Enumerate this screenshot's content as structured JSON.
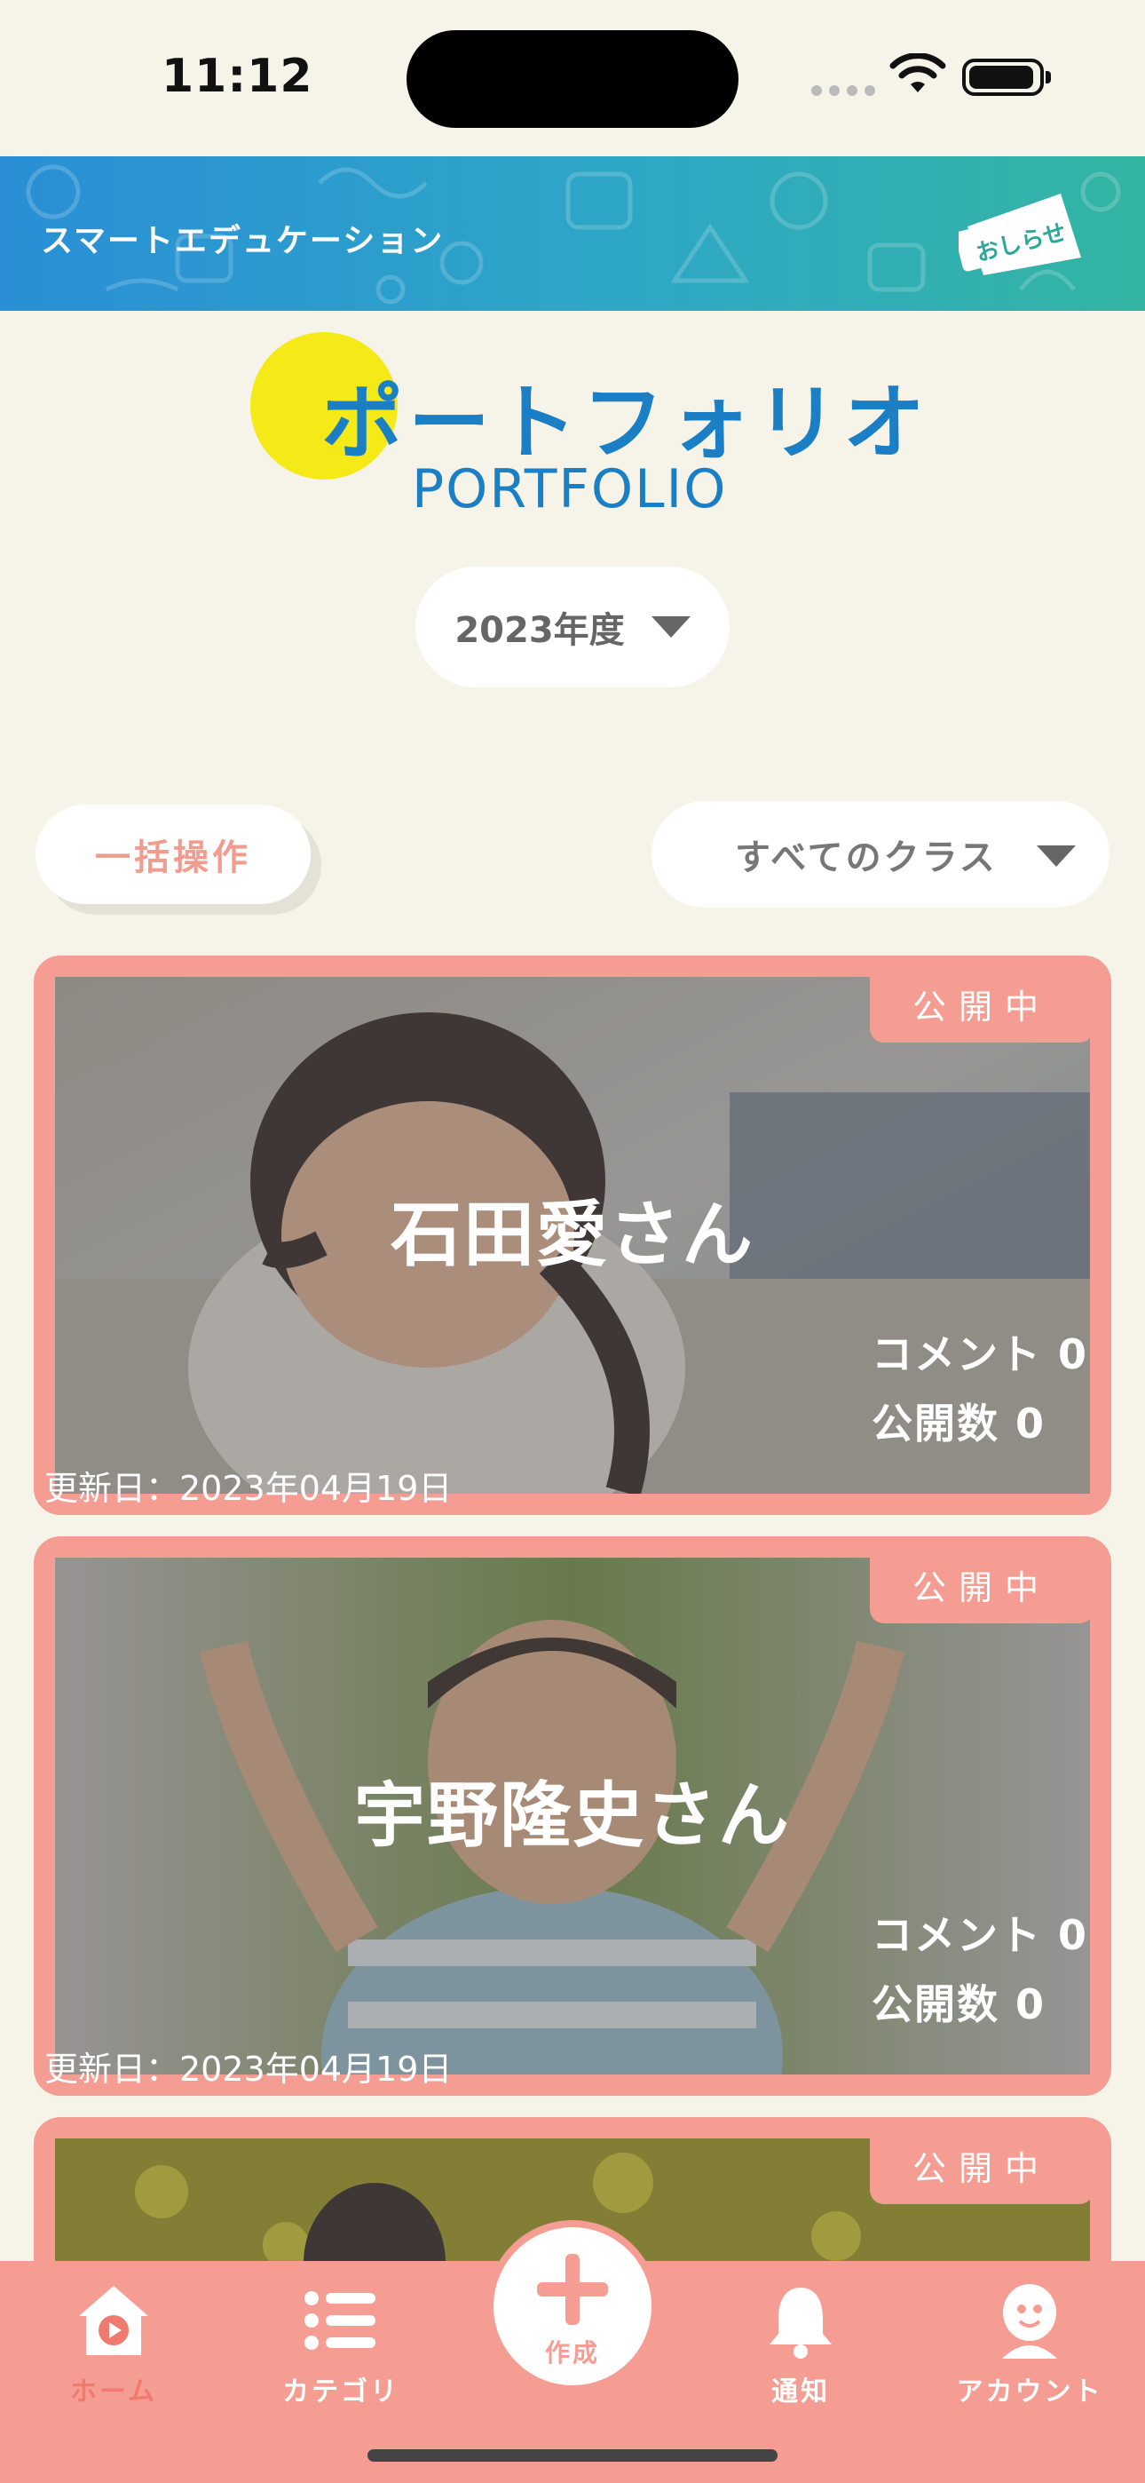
{
  "status_bar": {
    "time": "11:12"
  },
  "header": {
    "title": "スマートエデュケーション",
    "notice_label": "おしらせ"
  },
  "logo": {
    "jp": "ポートフォリオ",
    "en": "PORTFOLIO"
  },
  "year_select": {
    "value": "2023年度"
  },
  "toolbar": {
    "bulk_label": "一括操作",
    "class_filter": "すべてのクラス"
  },
  "cards": [
    {
      "status": "公開中",
      "name": "石田愛さん",
      "comments": "コメント 0",
      "published": "公開数 0",
      "updated": "更新日：2023年04月19日"
    },
    {
      "status": "公開中",
      "name": "宇野隆史さん",
      "comments": "コメント 0",
      "published": "公開数 0",
      "updated": "更新日：2023年04月19日"
    },
    {
      "status": "公開中"
    }
  ],
  "tabbar": {
    "home": "ホーム",
    "category": "カテゴリ",
    "create": "作成",
    "notifications": "通知",
    "account": "アカウント"
  },
  "colors": {
    "accent": "#f59d92",
    "header_start": "#2a8fd6",
    "header_end": "#33b5a2",
    "background": "#f6f3e9",
    "logo_blue": "#1a7fc4",
    "logo_yellow": "#f5e918"
  },
  "icons": [
    "wifi-icon",
    "battery-icon",
    "megaphone-icon",
    "home-icon",
    "list-icon",
    "plus-icon",
    "bell-icon",
    "account-icon",
    "dropdown-caret-icon"
  ]
}
